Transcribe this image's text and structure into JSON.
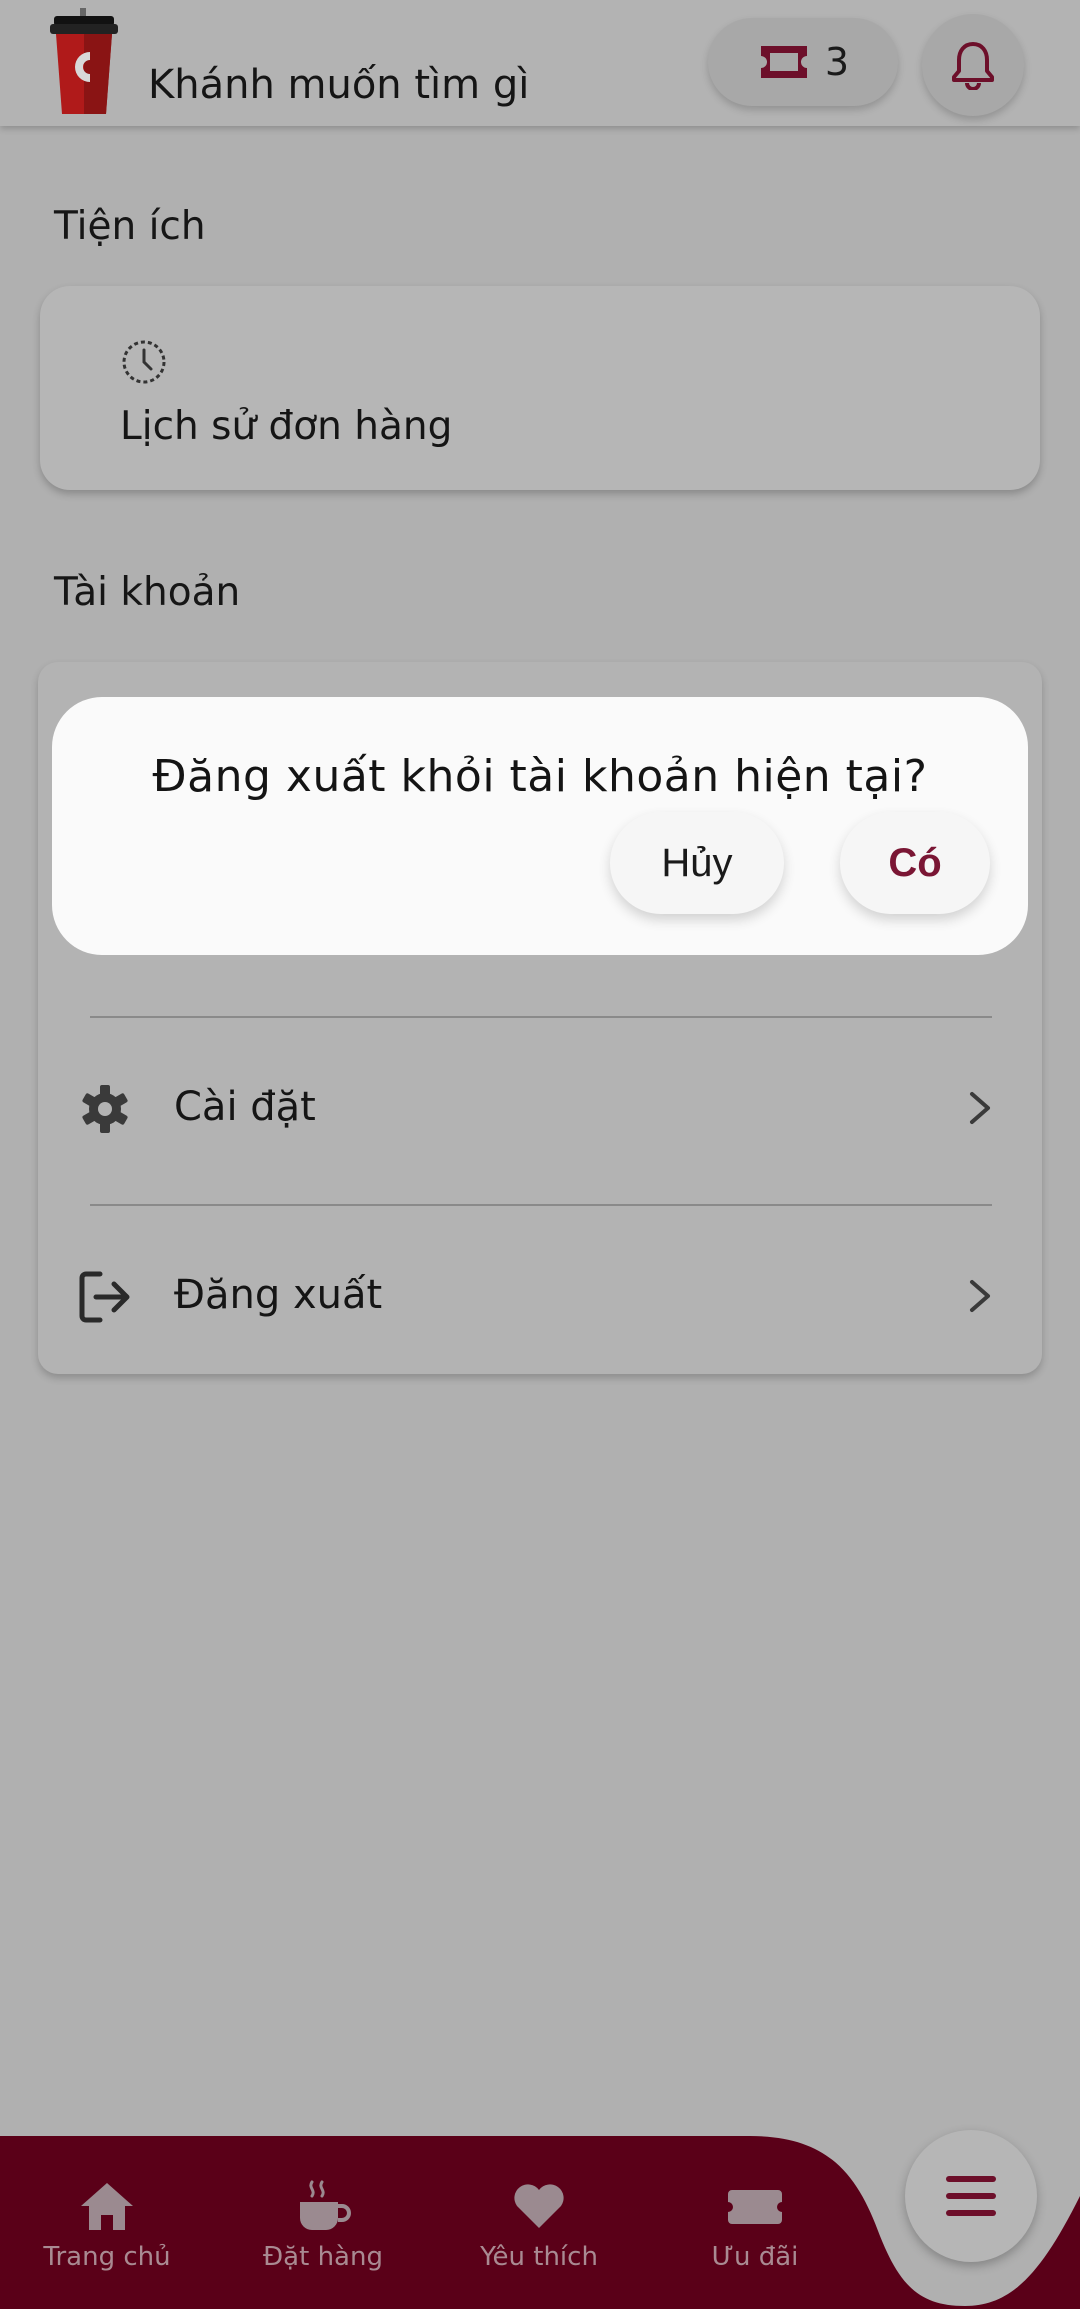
{
  "header": {
    "greeting": "Khánh muốn tìm gì",
    "voucher_count": "3",
    "icons": {
      "logo": "coffee-cup-logo",
      "voucher": "ticket-icon",
      "bell": "bell-icon"
    }
  },
  "utilities": {
    "title": "Tiện ích",
    "items": [
      {
        "label": "Lịch sử đơn hàng",
        "icon": "history-clock-icon"
      }
    ]
  },
  "account": {
    "title": "Tài khoản",
    "items": [
      {
        "label": "Cài đặt",
        "icon": "gear-icon"
      },
      {
        "label": "Đăng xuất",
        "icon": "logout-icon"
      }
    ]
  },
  "dialog": {
    "message": "Đăng xuất khỏi tài khoản hiện tại?",
    "cancel_label": "Hủy",
    "confirm_label": "Có"
  },
  "bottom_nav": {
    "items": [
      {
        "label": "Trang chủ",
        "icon": "home-icon"
      },
      {
        "label": "Đặt hàng",
        "icon": "coffee-cup-icon"
      },
      {
        "label": "Yêu thích",
        "icon": "heart-icon"
      },
      {
        "label": "Ưu đãi",
        "icon": "ticket-icon"
      }
    ],
    "menu_icon": "menu-icon"
  },
  "colors": {
    "brand": "#5a0018",
    "brand_accent": "#7a1634",
    "overlay_bg": "#b0b0b0",
    "dialog_bg": "#fafafa",
    "nav_label": "#a98a92"
  }
}
